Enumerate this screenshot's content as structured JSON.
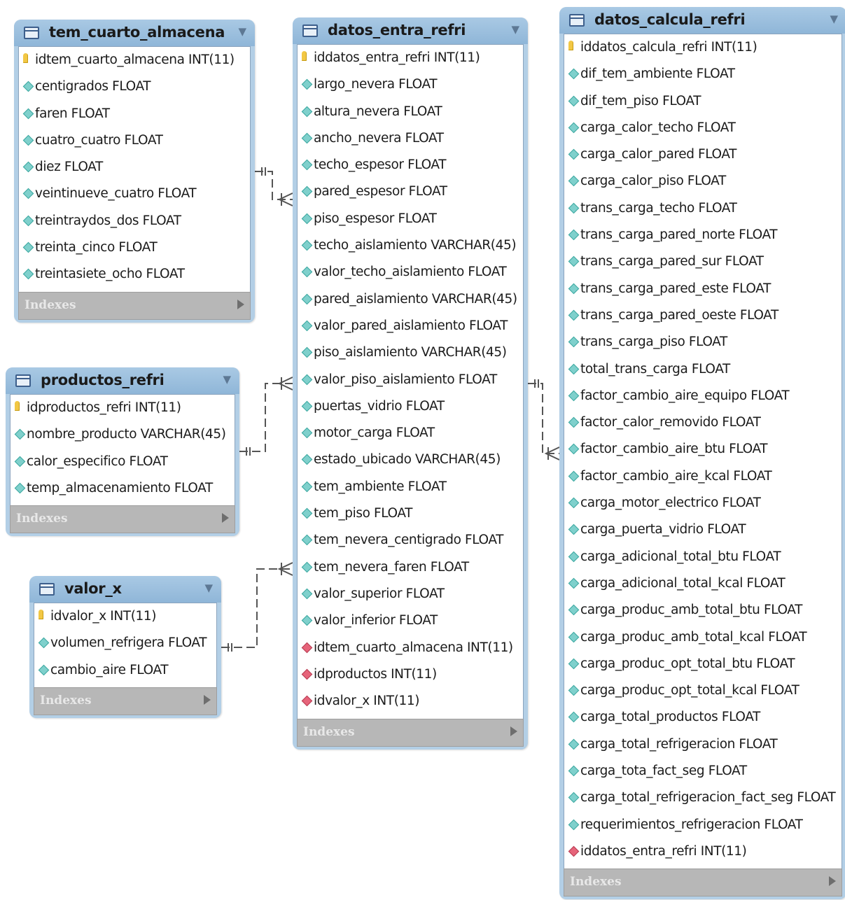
{
  "tables": {
    "tem_cuarto_almacena": {
      "name": "tem_cuarto_almacena",
      "columns": [
        {
          "kind": "pk",
          "text": "idtem_cuarto_almacena INT(11)"
        },
        {
          "kind": "col",
          "text": "centigrados FLOAT"
        },
        {
          "kind": "col",
          "text": "faren FLOAT"
        },
        {
          "kind": "col",
          "text": "cuatro_cuatro FLOAT"
        },
        {
          "kind": "col",
          "text": "diez FLOAT"
        },
        {
          "kind": "col",
          "text": "veintinueve_cuatro FLOAT"
        },
        {
          "kind": "col",
          "text": "treintraydos_dos FLOAT"
        },
        {
          "kind": "col",
          "text": "treinta_cinco FLOAT"
        },
        {
          "kind": "col",
          "text": "treintasiete_ocho FLOAT"
        }
      ],
      "footer": "Indexes"
    },
    "productos_refri": {
      "name": "productos_refri",
      "columns": [
        {
          "kind": "pk",
          "text": "idproductos_refri INT(11)"
        },
        {
          "kind": "col",
          "text": "nombre_producto VARCHAR(45)"
        },
        {
          "kind": "col",
          "text": "calor_especifico FLOAT"
        },
        {
          "kind": "col",
          "text": "temp_almacenamiento FLOAT"
        }
      ],
      "footer": "Indexes"
    },
    "valor_x": {
      "name": "valor_x",
      "columns": [
        {
          "kind": "pk",
          "text": "idvalor_x INT(11)"
        },
        {
          "kind": "col",
          "text": "volumen_refrigera FLOAT"
        },
        {
          "kind": "col",
          "text": "cambio_aire FLOAT"
        }
      ],
      "footer": "Indexes"
    },
    "datos_entra_refri": {
      "name": "datos_entra_refri",
      "columns": [
        {
          "kind": "pk",
          "text": "iddatos_entra_refri INT(11)"
        },
        {
          "kind": "col",
          "text": "largo_nevera FLOAT"
        },
        {
          "kind": "col",
          "text": "altura_nevera FLOAT"
        },
        {
          "kind": "col",
          "text": "ancho_nevera FLOAT"
        },
        {
          "kind": "col",
          "text": "techo_espesor FLOAT"
        },
        {
          "kind": "col",
          "text": "pared_espesor FLOAT"
        },
        {
          "kind": "col",
          "text": "piso_espesor FLOAT"
        },
        {
          "kind": "col",
          "text": "techo_aislamiento VARCHAR(45)"
        },
        {
          "kind": "col",
          "text": "valor_techo_aislamiento FLOAT"
        },
        {
          "kind": "col",
          "text": "pared_aislamiento VARCHAR(45)"
        },
        {
          "kind": "col",
          "text": "valor_pared_aislamiento FLOAT"
        },
        {
          "kind": "col",
          "text": "piso_aislamiento VARCHAR(45)"
        },
        {
          "kind": "col",
          "text": "valor_piso_aislamiento FLOAT"
        },
        {
          "kind": "col",
          "text": "puertas_vidrio FLOAT"
        },
        {
          "kind": "col",
          "text": "motor_carga FLOAT"
        },
        {
          "kind": "col",
          "text": "estado_ubicado VARCHAR(45)"
        },
        {
          "kind": "col",
          "text": "tem_ambiente FLOAT"
        },
        {
          "kind": "col",
          "text": "tem_piso FLOAT"
        },
        {
          "kind": "col",
          "text": "tem_nevera_centigrado FLOAT"
        },
        {
          "kind": "col",
          "text": "tem_nevera_faren FLOAT"
        },
        {
          "kind": "col",
          "text": "valor_superior FLOAT"
        },
        {
          "kind": "col",
          "text": "valor_inferior FLOAT"
        },
        {
          "kind": "fk",
          "text": "idtem_cuarto_almacena INT(11)"
        },
        {
          "kind": "fk",
          "text": "idproductos INT(11)"
        },
        {
          "kind": "fk",
          "text": "idvalor_x INT(11)"
        }
      ],
      "footer": "Indexes"
    },
    "datos_calcula_refri": {
      "name": "datos_calcula_refri",
      "columns": [
        {
          "kind": "pk",
          "text": "iddatos_calcula_refri INT(11)"
        },
        {
          "kind": "col",
          "text": "dif_tem_ambiente FLOAT"
        },
        {
          "kind": "col",
          "text": "dif_tem_piso FLOAT"
        },
        {
          "kind": "col",
          "text": "carga_calor_techo FLOAT"
        },
        {
          "kind": "col",
          "text": "carga_calor_pared FLOAT"
        },
        {
          "kind": "col",
          "text": "carga_calor_piso FLOAT"
        },
        {
          "kind": "col",
          "text": "trans_carga_techo FLOAT"
        },
        {
          "kind": "col",
          "text": "trans_carga_pared_norte FLOAT"
        },
        {
          "kind": "col",
          "text": "trans_carga_pared_sur FLOAT"
        },
        {
          "kind": "col",
          "text": "trans_carga_pared_este FLOAT"
        },
        {
          "kind": "col",
          "text": "trans_carga_pared_oeste FLOAT"
        },
        {
          "kind": "col",
          "text": "trans_carga_piso FLOAT"
        },
        {
          "kind": "col",
          "text": "total_trans_carga FLOAT"
        },
        {
          "kind": "col",
          "text": "factor_cambio_aire_equipo FLOAT"
        },
        {
          "kind": "col",
          "text": "factor_calor_removido FLOAT"
        },
        {
          "kind": "col",
          "text": "factor_cambio_aire_btu FLOAT"
        },
        {
          "kind": "col",
          "text": "factor_cambio_aire_kcal FLOAT"
        },
        {
          "kind": "col",
          "text": "carga_motor_electrico FLOAT"
        },
        {
          "kind": "col",
          "text": "carga_puerta_vidrio FLOAT"
        },
        {
          "kind": "col",
          "text": "carga_adicional_total_btu FLOAT"
        },
        {
          "kind": "col",
          "text": "carga_adicional_total_kcal FLOAT"
        },
        {
          "kind": "col",
          "text": "carga_produc_amb_total_btu FLOAT"
        },
        {
          "kind": "col",
          "text": "carga_produc_amb_total_kcal FLOAT"
        },
        {
          "kind": "col",
          "text": "carga_produc_opt_total_btu FLOAT"
        },
        {
          "kind": "col",
          "text": "carga_produc_opt_total_kcal FLOAT"
        },
        {
          "kind": "col",
          "text": "carga_total_productos FLOAT"
        },
        {
          "kind": "col",
          "text": "carga_total_refrigeracion FLOAT"
        },
        {
          "kind": "col",
          "text": "carga_tota_fact_seg FLOAT"
        },
        {
          "kind": "col",
          "text": "carga_total_refrigeracion_fact_seg FLOAT"
        },
        {
          "kind": "col",
          "text": "requerimientos_refrigeracion FLOAT"
        },
        {
          "kind": "fk",
          "text": "iddatos_entra_refri INT(11)"
        }
      ],
      "footer": "Indexes"
    }
  },
  "colors": {
    "header": "#a9c9e4",
    "frame": "#b3cfe6",
    "footer": "#b7b7b7",
    "line": "#555555"
  }
}
